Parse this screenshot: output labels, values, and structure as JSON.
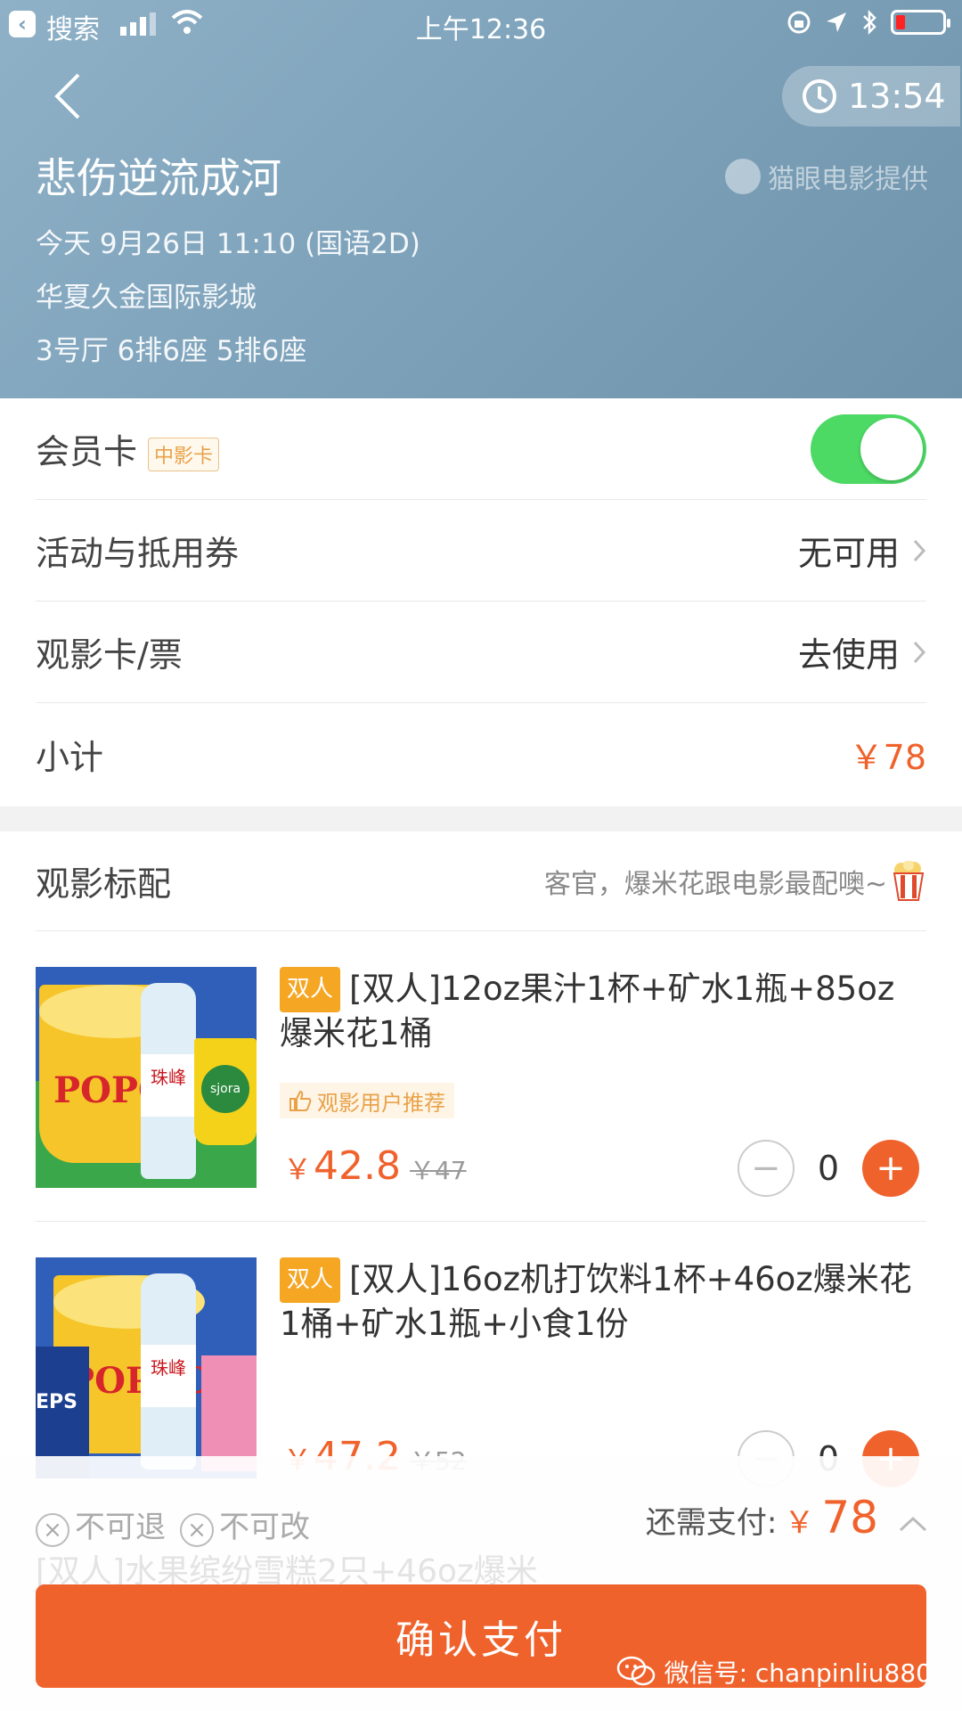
{
  "status_bar": {
    "back_app": "搜索",
    "time": "上午12:36"
  },
  "header": {
    "timer": "13:54",
    "movie_title": "悲伤逆流成河",
    "provider": "猫眼电影提供",
    "showtime": "今天 9月26日 11:10 (国语2D)",
    "cinema": "华夏久金国际影城",
    "seats": "3号厅 6排6座 5排6座"
  },
  "member_card": {
    "label": "会员卡",
    "tag": "中影卡",
    "toggle_on": true
  },
  "rows": [
    {
      "label": "活动与抵用券",
      "value": "无可用"
    },
    {
      "label": "观影卡/票",
      "value": "去使用"
    }
  ],
  "subtotal": {
    "label": "小计",
    "value": "￥78"
  },
  "snacks": {
    "title": "观影标配",
    "subtitle": "客官，爆米花跟电影最配噢~",
    "items": [
      {
        "badge": "双人",
        "name": "[双人]12oz果汁1杯+矿水1瓶+85oz爆米花1桶",
        "recommend": "观影用户推荐",
        "yen": "￥",
        "price": "42.8",
        "original": "￥47",
        "qty": "0",
        "thumb_text": "POPCO"
      },
      {
        "badge": "双人",
        "name": "[双人]16oz机打饮料1杯+46oz爆米花1桶+矿水1瓶+小食1份",
        "yen": "￥",
        "price": "47.2",
        "original": "￥52",
        "qty": "0",
        "thumb_text": "POPCO"
      }
    ],
    "next_item_preview": "[双人]水果缤纷雪糕2只+46oz爆米"
  },
  "bottom_bar": {
    "no_refund": "不可退",
    "no_change": "不可改",
    "need_pay_label": "还需支付:",
    "yen": "￥",
    "amount": "78",
    "confirm_button": "确认支付",
    "watermark": "微信号: chanpinliu880"
  },
  "colors": {
    "accent": "#f0622c",
    "toggle": "#4cd964",
    "badge": "#f5a623",
    "header_bg": "#7ea3bb"
  }
}
